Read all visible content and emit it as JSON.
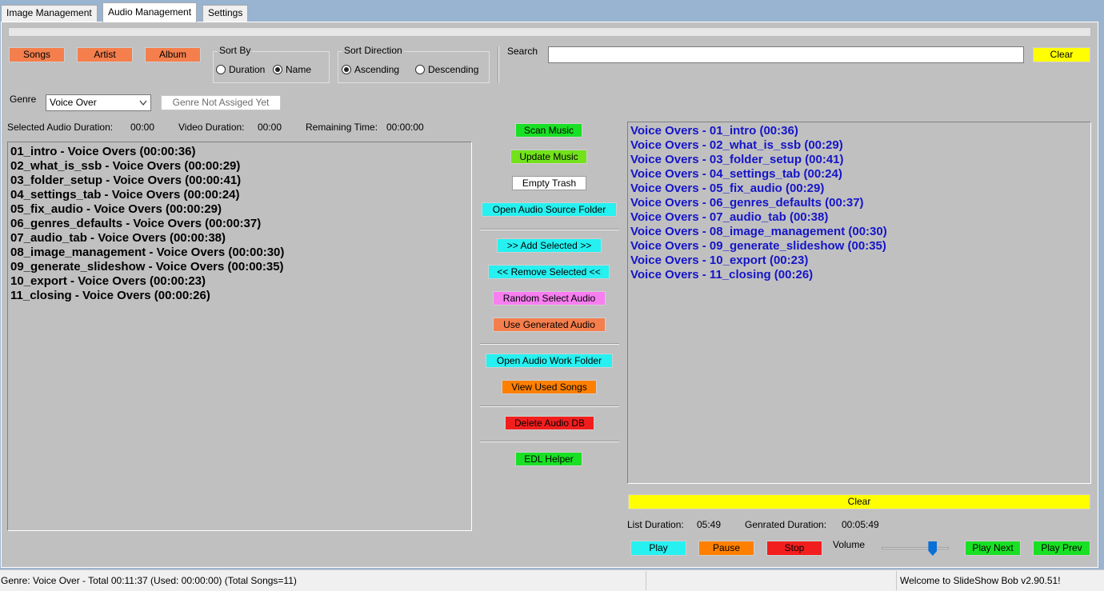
{
  "tabs": [
    {
      "label": "Image Management",
      "active": false
    },
    {
      "label": "Audio Management",
      "active": true
    },
    {
      "label": "Settings",
      "active": false
    }
  ],
  "filter_buttons": {
    "songs": "Songs",
    "artist": "Artist",
    "album": "Album"
  },
  "sort_by": {
    "label": "Sort By",
    "options": [
      "Duration",
      "Name"
    ],
    "selected": "Name"
  },
  "sort_direction": {
    "label": "Sort Direction",
    "options": [
      "Ascending",
      "Descending"
    ],
    "selected": "Ascending"
  },
  "search": {
    "label": "Search",
    "value": "",
    "clear_label": "Clear"
  },
  "genre": {
    "label": "Genre",
    "selected": "Voice Over",
    "status": "Genre Not Assiged Yet"
  },
  "durations": {
    "selected_label": "Selected Audio Duration:",
    "selected_value": "00:00",
    "video_label": "Video Duration:",
    "video_value": "00:00",
    "remaining_label": "Remaining Time:",
    "remaining_value": "00:00:00"
  },
  "available_list": [
    "01_intro - Voice Overs (00:00:36)",
    "02_what_is_ssb - Voice Overs (00:00:29)",
    "03_folder_setup - Voice Overs (00:00:41)",
    "04_settings_tab - Voice Overs (00:00:24)",
    "05_fix_audio - Voice Overs (00:00:29)",
    "06_genres_defaults - Voice Overs (00:00:37)",
    "07_audio_tab - Voice Overs (00:00:38)",
    "08_image_management - Voice Overs (00:00:30)",
    "09_generate_slideshow - Voice Overs (00:00:35)",
    "10_export - Voice Overs (00:00:23)",
    "11_closing - Voice Overs (00:00:26)"
  ],
  "selected_list": [
    "Voice Overs - 01_intro (00:36)",
    "Voice Overs - 02_what_is_ssb (00:29)",
    "Voice Overs - 03_folder_setup (00:41)",
    "Voice Overs - 04_settings_tab (00:24)",
    "Voice Overs - 05_fix_audio (00:29)",
    "Voice Overs - 06_genres_defaults (00:37)",
    "Voice Overs - 07_audio_tab (00:38)",
    "Voice Overs - 08_image_management (00:30)",
    "Voice Overs - 09_generate_slideshow (00:35)",
    "Voice Overs - 10_export (00:23)",
    "Voice Overs - 11_closing (00:26)"
  ],
  "actions": {
    "scan_music": "Scan Music",
    "update_music": "Update Music",
    "empty_trash": "Empty Trash",
    "open_source_folder": "Open Audio Source Folder",
    "add_selected": ">> Add Selected >>",
    "remove_selected": "<< Remove Selected <<",
    "random_select": "Random Select Audio",
    "use_generated": "Use Generated Audio",
    "open_work_folder": "Open Audio Work Folder",
    "view_used": "View Used Songs",
    "delete_db": "Delete Audio DB",
    "edl_helper": "EDL Helper"
  },
  "list_clear_label": "Clear",
  "list_info": {
    "list_duration_label": "List Duration:",
    "list_duration_value": "05:49",
    "generated_label": "Genrated Duration:",
    "generated_value": "00:05:49"
  },
  "player": {
    "play": "Play",
    "pause": "Pause",
    "stop": "Stop",
    "volume_label": "Volume",
    "volume_level": 0.8,
    "play_next": "Play Next",
    "play_prev": "Play Prev"
  },
  "status": {
    "left": "Genre: Voice Over - Total 00:11:37 (Used: 00:00:00) (Total Songs=11)",
    "right": "Welcome to SlideShow Bob v2.90.51!"
  },
  "colors": {
    "orange": "#f47f4d",
    "yellow": "#ffff00",
    "green": "#19e025",
    "cyan": "#27f0f0",
    "pink": "#f77ff0",
    "amber": "#ff8000",
    "red": "#f21e1e",
    "list_blue": "#1515c8"
  }
}
